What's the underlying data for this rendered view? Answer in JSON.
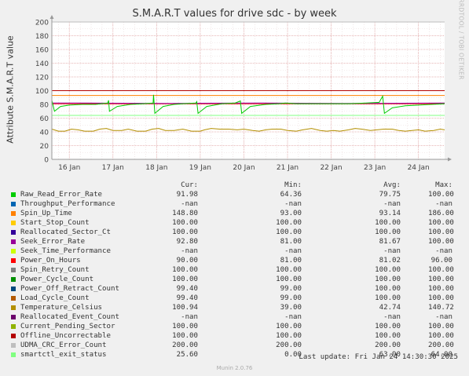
{
  "title": "S.M.A.R.T values for drive sdc - by week",
  "side_text": "RRDTOOL / TOBI OETIKER",
  "footer": "Munin 2.0.76",
  "last_update": "Last update: Fri Jan 24 14:30:30 2025",
  "legend_headers": {
    "cur": "Cur:",
    "min": "Min:",
    "avg": "Avg:",
    "max": "Max:"
  },
  "legend": [
    {
      "name": "Raw_Read_Error_Rate",
      "color": "#00cc00",
      "cur": "91.98",
      "min": "64.36",
      "avg": "79.75",
      "max": "100.00"
    },
    {
      "name": "Throughput_Performance",
      "color": "#0066b3",
      "cur": "-nan",
      "min": "-nan",
      "avg": "-nan",
      "max": "-nan"
    },
    {
      "name": "Spin_Up_Time",
      "color": "#ff8000",
      "cur": "148.80",
      "min": "93.00",
      "avg": "93.14",
      "max": "186.00"
    },
    {
      "name": "Start_Stop_Count",
      "color": "#ffcc00",
      "cur": "100.00",
      "min": "100.00",
      "avg": "100.00",
      "max": "100.00"
    },
    {
      "name": "Reallocated_Sector_Ct",
      "color": "#330099",
      "cur": "100.00",
      "min": "100.00",
      "avg": "100.00",
      "max": "100.00"
    },
    {
      "name": "Seek_Error_Rate",
      "color": "#990099",
      "cur": "92.80",
      "min": "81.00",
      "avg": "81.67",
      "max": "100.00"
    },
    {
      "name": "Seek_Time_Performance",
      "color": "#ccff00",
      "cur": "-nan",
      "min": "-nan",
      "avg": "-nan",
      "max": "-nan"
    },
    {
      "name": "Power_On_Hours",
      "color": "#ff0000",
      "cur": "90.00",
      "min": "81.00",
      "avg": "81.02",
      "max": "96.00"
    },
    {
      "name": "Spin_Retry_Count",
      "color": "#808080",
      "cur": "100.00",
      "min": "100.00",
      "avg": "100.00",
      "max": "100.00"
    },
    {
      "name": "Power_Cycle_Count",
      "color": "#008f00",
      "cur": "100.00",
      "min": "100.00",
      "avg": "100.00",
      "max": "100.00"
    },
    {
      "name": "Power_Off_Retract_Count",
      "color": "#00487d",
      "cur": "99.40",
      "min": "99.00",
      "avg": "100.00",
      "max": "100.00"
    },
    {
      "name": "Load_Cycle_Count",
      "color": "#b35a00",
      "cur": "99.40",
      "min": "99.00",
      "avg": "100.00",
      "max": "100.00"
    },
    {
      "name": "Temperature_Celsius",
      "color": "#b38f00",
      "cur": "100.94",
      "min": "39.00",
      "avg": "42.74",
      "max": "140.72"
    },
    {
      "name": "Reallocated_Event_Count",
      "color": "#6b006b",
      "cur": "-nan",
      "min": "-nan",
      "avg": "-nan",
      "max": "-nan"
    },
    {
      "name": "Current_Pending_Sector",
      "color": "#8fb300",
      "cur": "100.00",
      "min": "100.00",
      "avg": "100.00",
      "max": "100.00"
    },
    {
      "name": "Offline_Uncorrectable",
      "color": "#b30000",
      "cur": "100.00",
      "min": "100.00",
      "avg": "100.00",
      "max": "100.00"
    },
    {
      "name": "UDMA_CRC_Error_Count",
      "color": "#bebebe",
      "cur": "200.00",
      "min": "200.00",
      "avg": "200.00",
      "max": "200.00"
    },
    {
      "name": "smartctl_exit_status",
      "color": "#80ff80",
      "cur": "25.60",
      "min": "0.00",
      "avg": "63.90",
      "max": "64.00"
    }
  ],
  "chart_data": {
    "type": "line",
    "title": "S.M.A.R.T values for drive sdc - by week",
    "ylabel": "Attribute S.M.A.R.T value",
    "ylim": [
      0,
      200
    ],
    "yticks": [
      0,
      20,
      40,
      60,
      80,
      100,
      120,
      140,
      160,
      180,
      200
    ],
    "x_range_days": [
      15.6,
      24.6
    ],
    "xticks": [
      {
        "label": "16 Jan",
        "day": 16
      },
      {
        "label": "17 Jan",
        "day": 17
      },
      {
        "label": "18 Jan",
        "day": 18
      },
      {
        "label": "19 Jan",
        "day": 19
      },
      {
        "label": "20 Jan",
        "day": 20
      },
      {
        "label": "21 Jan",
        "day": 21
      },
      {
        "label": "22 Jan",
        "day": 22
      },
      {
        "label": "23 Jan",
        "day": 23
      },
      {
        "label": "24 Jan",
        "day": 24
      }
    ],
    "grid": true,
    "series": [
      {
        "name": "UDMA_CRC_Error_Count",
        "color": "#bebebe",
        "points": [
          [
            15.6,
            200
          ],
          [
            24.6,
            200
          ]
        ]
      },
      {
        "name": "Start_Stop_Count",
        "color": "#ffcc00",
        "points": [
          [
            15.6,
            100
          ],
          [
            24.6,
            100
          ]
        ]
      },
      {
        "name": "Reallocated_Sector_Ct",
        "color": "#330099",
        "points": [
          [
            15.6,
            100
          ],
          [
            24.6,
            100
          ]
        ]
      },
      {
        "name": "Offline_Uncorrectable",
        "color": "#b30000",
        "points": [
          [
            15.6,
            100
          ],
          [
            24.6,
            100
          ]
        ]
      },
      {
        "name": "Spin_Up_Time",
        "color": "#ff8000",
        "points": [
          [
            15.6,
            93
          ],
          [
            24.6,
            93
          ]
        ]
      },
      {
        "name": "Power_On_Hours",
        "color": "#ff0000",
        "points": [
          [
            15.6,
            81
          ],
          [
            24.6,
            81
          ]
        ]
      },
      {
        "name": "Seek_Error_Rate",
        "color": "#990099",
        "points": [
          [
            15.6,
            82
          ],
          [
            16.4,
            82
          ],
          [
            18.3,
            81.5
          ],
          [
            20.4,
            82
          ],
          [
            22.3,
            81.5
          ],
          [
            24.6,
            82
          ]
        ]
      },
      {
        "name": "smartctl_exit_status",
        "color": "#80ff80",
        "points": [
          [
            15.6,
            64
          ],
          [
            24.6,
            64
          ]
        ]
      },
      {
        "name": "Raw_Read_Error_Rate",
        "color": "#00cc00",
        "points": [
          [
            15.6,
            86
          ],
          [
            15.66,
            70
          ],
          [
            15.8,
            77
          ],
          [
            16.0,
            79
          ],
          [
            16.3,
            80
          ],
          [
            16.6,
            80
          ],
          [
            16.88,
            82
          ],
          [
            16.9,
            86
          ],
          [
            16.92,
            70
          ],
          [
            17.1,
            77
          ],
          [
            17.4,
            80
          ],
          [
            17.7,
            81
          ],
          [
            17.92,
            82
          ],
          [
            17.93,
            94
          ],
          [
            17.96,
            67
          ],
          [
            18.15,
            77
          ],
          [
            18.4,
            80
          ],
          [
            18.6,
            81
          ],
          [
            18.9,
            82
          ],
          [
            18.92,
            84
          ],
          [
            18.95,
            67
          ],
          [
            19.15,
            77
          ],
          [
            19.5,
            81
          ],
          [
            19.8,
            82
          ],
          [
            19.92,
            85
          ],
          [
            19.95,
            67
          ],
          [
            20.15,
            77
          ],
          [
            20.5,
            80
          ],
          [
            20.8,
            81
          ],
          [
            20.95,
            82
          ],
          [
            21.2,
            81
          ],
          [
            21.6,
            81
          ],
          [
            22.0,
            81
          ],
          [
            22.4,
            81
          ],
          [
            22.8,
            82
          ],
          [
            23.1,
            83
          ],
          [
            23.18,
            92
          ],
          [
            23.22,
            67
          ],
          [
            23.4,
            75
          ],
          [
            23.7,
            78
          ],
          [
            24.0,
            79
          ],
          [
            24.3,
            80
          ],
          [
            24.6,
            81
          ]
        ]
      },
      {
        "name": "Temperature_Celsius",
        "color": "#b38f00",
        "points": [
          [
            15.6,
            44
          ],
          [
            15.75,
            41
          ],
          [
            15.9,
            41
          ],
          [
            16.05,
            44
          ],
          [
            16.2,
            43
          ],
          [
            16.35,
            41
          ],
          [
            16.55,
            41
          ],
          [
            16.7,
            44
          ],
          [
            16.85,
            45
          ],
          [
            17.0,
            42
          ],
          [
            17.2,
            42
          ],
          [
            17.35,
            44
          ],
          [
            17.55,
            41
          ],
          [
            17.75,
            41
          ],
          [
            17.9,
            44
          ],
          [
            18.05,
            45
          ],
          [
            18.2,
            42
          ],
          [
            18.4,
            42
          ],
          [
            18.6,
            44
          ],
          [
            18.8,
            41
          ],
          [
            19.0,
            41
          ],
          [
            19.1,
            43
          ],
          [
            19.25,
            45
          ],
          [
            19.45,
            44
          ],
          [
            19.65,
            44
          ],
          [
            19.85,
            43
          ],
          [
            20.0,
            44
          ],
          [
            20.2,
            42
          ],
          [
            20.35,
            41
          ],
          [
            20.5,
            43
          ],
          [
            20.65,
            44
          ],
          [
            20.85,
            44
          ],
          [
            21.0,
            42
          ],
          [
            21.2,
            41
          ],
          [
            21.35,
            43
          ],
          [
            21.55,
            45
          ],
          [
            21.75,
            42
          ],
          [
            21.9,
            41
          ],
          [
            22.05,
            42
          ],
          [
            22.2,
            41
          ],
          [
            22.4,
            43
          ],
          [
            22.55,
            45
          ],
          [
            22.7,
            44
          ],
          [
            22.9,
            42
          ],
          [
            23.05,
            43
          ],
          [
            23.2,
            44
          ],
          [
            23.4,
            44
          ],
          [
            23.55,
            42
          ],
          [
            23.7,
            41
          ],
          [
            23.85,
            42
          ],
          [
            24.0,
            43
          ],
          [
            24.15,
            41
          ],
          [
            24.35,
            42
          ],
          [
            24.5,
            44
          ],
          [
            24.6,
            43
          ]
        ]
      },
      {
        "name": "Power_Off_Retract_Count",
        "color": "#00487d",
        "points": [
          [
            15.6,
            0
          ],
          [
            24.6,
            0
          ]
        ]
      }
    ]
  }
}
